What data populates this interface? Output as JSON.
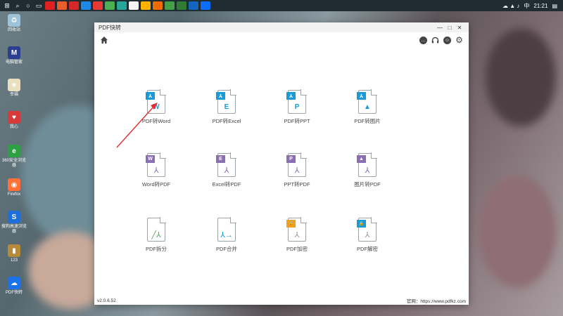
{
  "taskbar": {
    "time": "21:21",
    "ime": "中",
    "apps": [
      "#e02020",
      "#e85d2a",
      "#d62828",
      "#1e88e5",
      "#e53935",
      "#4caf50",
      "#26a69a",
      "#f5f5f5",
      "#ffb300",
      "#ef6c00",
      "#43a047",
      "#2e7d32",
      "#1565c0",
      "#0d6efd"
    ]
  },
  "desktop": [
    {
      "label": "回收站",
      "color": "#9ec3d8",
      "glyph": "♻"
    },
    {
      "label": "电脑管家",
      "color": "#2c3e8f",
      "glyph": "M"
    },
    {
      "label": "幸福",
      "color": "#e8e0c0",
      "glyph": "★"
    },
    {
      "label": "我心",
      "color": "#d73a3a",
      "glyph": "♥"
    },
    {
      "label": "360安全浏览器",
      "color": "#2ea043",
      "glyph": "e"
    },
    {
      "label": "Firefox",
      "color": "#ff7139",
      "glyph": "◉"
    },
    {
      "label": "搜狗高速浏览器",
      "color": "#1e6fd9",
      "glyph": "S"
    },
    {
      "label": "123",
      "color": "#b58a3a",
      "glyph": "▮"
    },
    {
      "label": "PDF快转",
      "color": "#1a73e8",
      "glyph": "☁"
    }
  ],
  "window": {
    "title": "PDF快转",
    "minimize": "—",
    "maximize": "□",
    "close": "✕",
    "version": "v2.0.6.52",
    "site": "官网：https://www.pdfkz.com",
    "tools": [
      {
        "label": "PDF转Word",
        "kind": "pdf2",
        "letter": "W",
        "color": "#1a9bd7"
      },
      {
        "label": "PDF转Excel",
        "kind": "pdf2",
        "letter": "E",
        "color": "#1a9bd7"
      },
      {
        "label": "PDF转PPT",
        "kind": "pdf2",
        "letter": "P",
        "color": "#1a9bd7"
      },
      {
        "label": "PDF转图片",
        "kind": "pdf2",
        "letter": "▲",
        "color": "#1a9bd7"
      },
      {
        "label": "Word转PDF",
        "kind": "2pdf",
        "letter": "W",
        "color": "#8a6fb3"
      },
      {
        "label": "Excel转PDF",
        "kind": "2pdf",
        "letter": "E",
        "color": "#8a6fb3"
      },
      {
        "label": "PPT转PDF",
        "kind": "2pdf",
        "letter": "P",
        "color": "#8a6fb3"
      },
      {
        "label": "图片转PDF",
        "kind": "2pdf",
        "letter": "▲",
        "color": "#8a6fb3"
      },
      {
        "label": "PDF拆分",
        "kind": "split",
        "letter": "",
        "color": "#5aa469"
      },
      {
        "label": "PDF合并",
        "kind": "merge",
        "letter": "",
        "color": "#1a9bd7"
      },
      {
        "label": "PDF加密",
        "kind": "lock",
        "letter": "",
        "color": "#f0a020"
      },
      {
        "label": "PDF解密",
        "kind": "unlock",
        "letter": "",
        "color": "#1a9bd7"
      }
    ]
  }
}
